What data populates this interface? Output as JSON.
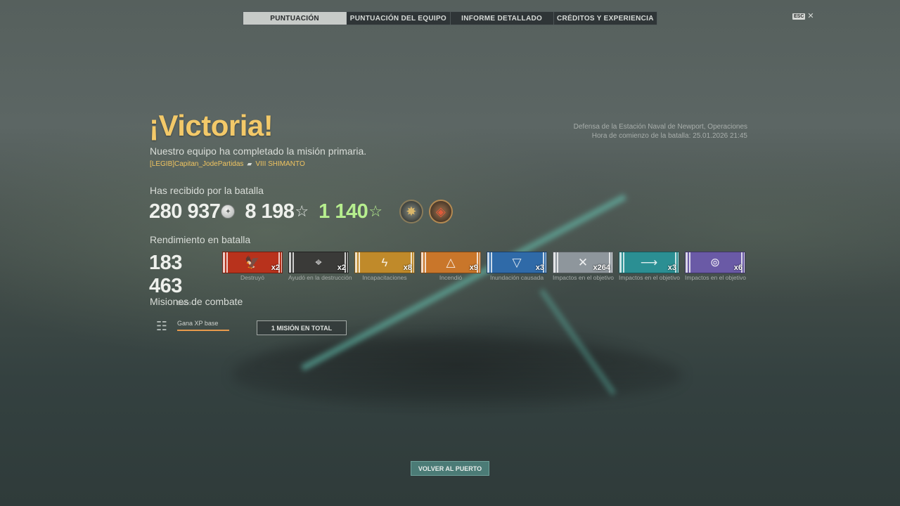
{
  "tabs": [
    {
      "label": "PUNTUACIÓN",
      "active": true
    },
    {
      "label": "PUNTUACIÓN DEL EQUIPO",
      "active": false
    },
    {
      "label": "INFORME DETALLADO",
      "active": false
    },
    {
      "label": "CRÉDITOS Y EXPERIENCIA",
      "active": false
    }
  ],
  "close": {
    "key_label": "ESC",
    "icon": "close-icon"
  },
  "header": {
    "title": "¡Victoria!",
    "subtitle": "Nuestro equipo ha completado la misión primaria.",
    "player": "[LEGIB]Capitan_JodePartidas",
    "ship": "VIII SHIMANTO",
    "mode_line": "Defensa de la Estación Naval de Newport, Operaciones",
    "time_line": "Hora de comienzo de la batalla: 25.01.2026 21:45"
  },
  "received": {
    "title": "Has recibido por la batalla",
    "credits": "280 937",
    "base_xp": "8 198",
    "free_xp": "1 140",
    "credits_icon": "credits-icon",
    "xp_icon": "star-icon",
    "medals": [
      "achievement-medal-icon",
      "achievement-medal-icon"
    ]
  },
  "performance": {
    "title": "Rendimiento en batalla",
    "damage": "183 463",
    "damage_label": "Daño",
    "ribbons": [
      {
        "label": "Destruyó",
        "count": "x2",
        "color": "#b8321c",
        "icon": "destroyed-icon",
        "glyph": "🦅"
      },
      {
        "label": "Ayudó en la destrucción",
        "count": "x2",
        "color": "#3a3a38",
        "icon": "crosshair-icon",
        "glyph": "⌖"
      },
      {
        "label": "Incapacitaciones",
        "count": "x8",
        "color": "#c08a2a",
        "icon": "lightning-icon",
        "glyph": "ϟ"
      },
      {
        "label": "Incendió",
        "count": "x9",
        "color": "#c9762a",
        "icon": "fire-icon",
        "glyph": "△"
      },
      {
        "label": "Inundación causada",
        "count": "x3",
        "color": "#2f6aa8",
        "icon": "flood-icon",
        "glyph": "▽"
      },
      {
        "label": "Impactos en el objetivo",
        "count": "x264",
        "color": "#8e969c",
        "icon": "shell-hit-icon",
        "glyph": "✕"
      },
      {
        "label": "Impactos en el objetivo",
        "count": "x3",
        "color": "#2b8f93",
        "icon": "torpedo-hit-icon",
        "glyph": "⟶"
      },
      {
        "label": "Impactos en el objetivo",
        "count": "x6",
        "color": "#6a5aa6",
        "icon": "secondary-hit-icon",
        "glyph": "⊚"
      }
    ]
  },
  "missions": {
    "title": "Misiones de combate",
    "mission_label": "Gana XP base",
    "mission_progress": 1.0,
    "total_button": "1 MISIÓN EN TOTAL",
    "icon": "coins-stack-icon"
  },
  "footer": {
    "port_button": "VOLVER AL PUERTO"
  }
}
